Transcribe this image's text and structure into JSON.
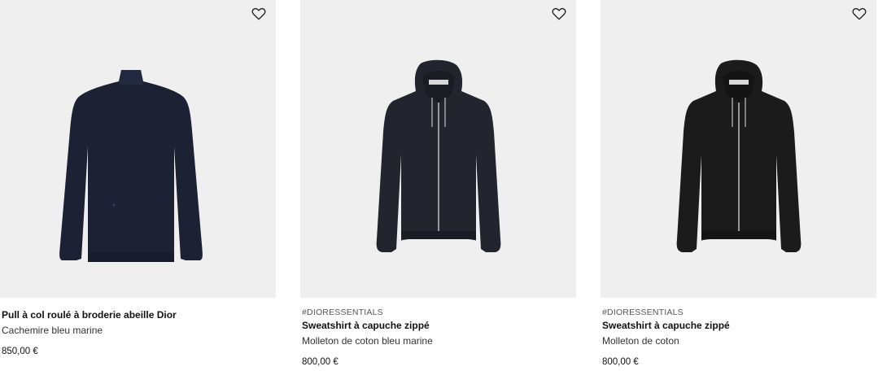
{
  "products": [
    {
      "tag": "",
      "name": "Pull à col roulé à broderie abeille Dior",
      "subtitle": "Cachemire bleu marine",
      "price": "850,00 €",
      "image_icon": "turtleneck-sweater-image",
      "color": "#1c2133"
    },
    {
      "tag": "#DIORESSENTIALS",
      "name": "Sweatshirt à capuche zippé",
      "subtitle": "Molleton de coton bleu marine",
      "price": "800,00 €",
      "image_icon": "zip-hoodie-image",
      "color": "#22242e"
    },
    {
      "tag": "#DIORESSENTIALS",
      "name": "Sweatshirt à capuche zippé",
      "subtitle": "Molleton de coton",
      "price": "800,00 €",
      "image_icon": "zip-hoodie-image",
      "color": "#1b1b1b"
    }
  ],
  "favorite_icon": "heart-outline-icon",
  "colors": {
    "image_bg": "#efefef",
    "text": "#111111"
  }
}
